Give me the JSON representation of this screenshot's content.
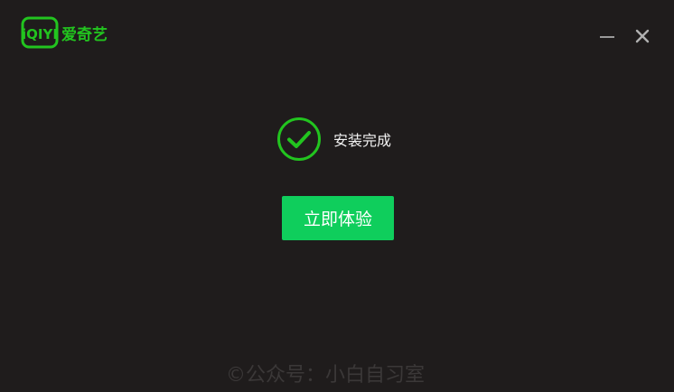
{
  "app": {
    "logo_brand_text": "iQIYI",
    "logo_cn_text": "爱奇艺"
  },
  "window_controls": {
    "minimize_icon": "minimize-icon",
    "close_icon": "close-icon"
  },
  "status": {
    "icon": "check-circle-icon",
    "text": "安装完成"
  },
  "primary_button": {
    "label": "立即体验"
  },
  "watermark": {
    "text": "©公众号：小白自习室"
  },
  "colors": {
    "background": "#1f1c1c",
    "brand_green": "#22c41f",
    "button_green": "#0fce5c",
    "status_text": "#f2f2f2",
    "control_gray": "#9a9a9a"
  }
}
